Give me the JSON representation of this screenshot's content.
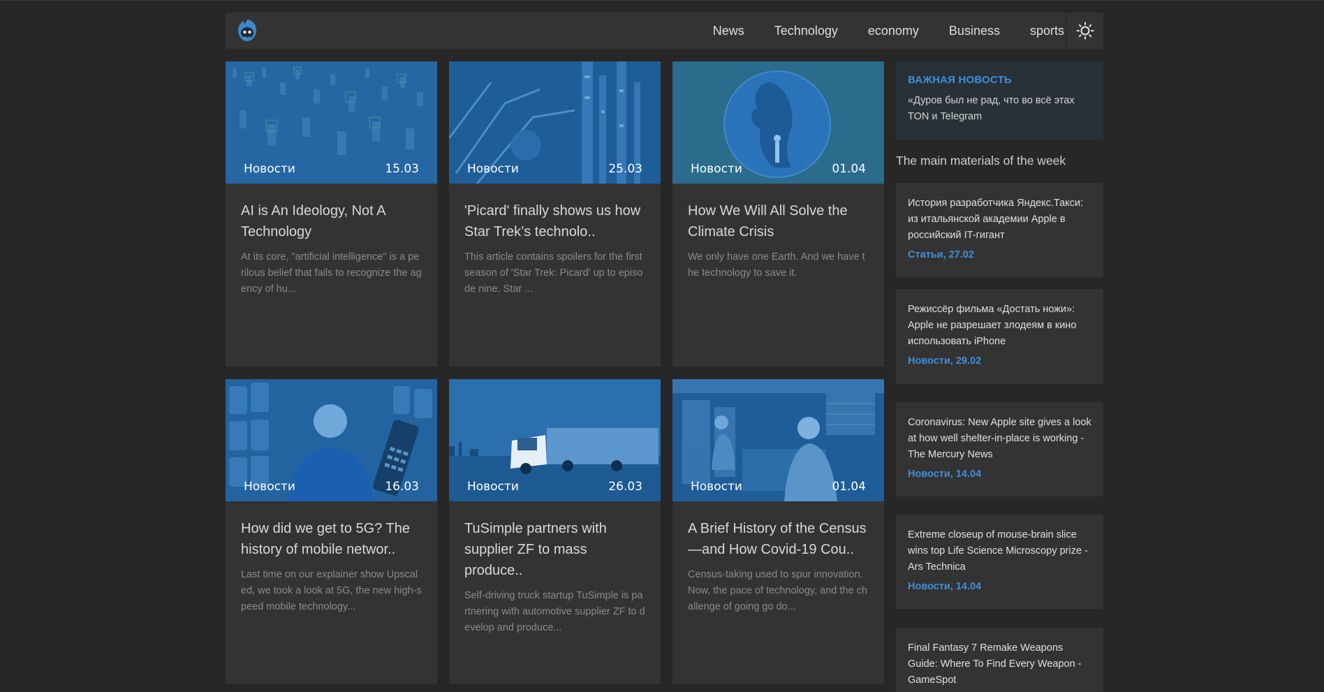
{
  "nav": {
    "items": [
      {
        "label": "News"
      },
      {
        "label": "Technology"
      },
      {
        "label": "economy"
      },
      {
        "label": "Business"
      },
      {
        "label": "sports"
      }
    ]
  },
  "cards": [
    {
      "tag": "Новости",
      "date": "15.03",
      "title": "AI is An Ideology, Not A Technology",
      "text": "At its core, \"artificial intelligence\" is a perilous belief that fails to recognize the agency of hu..."
    },
    {
      "tag": "Новости",
      "date": "25.03",
      "title": "'Picard' finally shows us how Star Trek’s technolo..",
      "text": "This article contains spoilers for the first season of 'Star Trek: Picard' up to episode nine. Star ..."
    },
    {
      "tag": "Новости",
      "date": "01.04",
      "title": "How We Will All Solve the Climate Crisis",
      "text": "We only have one Earth. And we have the technology to save it."
    },
    {
      "tag": "Новости",
      "date": "16.03",
      "title": "How did we get to 5G? The history of mobile networ..",
      "text": "Last time on our explainer show Upscaled, we took a look at 5G, the new high-speed mobile technology..."
    },
    {
      "tag": "Новости",
      "date": "26.03",
      "title": "TuSimple partners with supplier ZF to mass produce..",
      "text": "Self-driving truck startup TuSimple is partnering with automotive supplier ZF to develop and produce..."
    },
    {
      "tag": "Новости",
      "date": "01.04",
      "title": "A Brief History of the Census—and How Covid-19 Cou..",
      "text": "Census-taking used to spur innovation. Now, the pace of technology, and the challenge of going go do..."
    }
  ],
  "sidebar": {
    "important_label": "ВАЖНАЯ НОВОСТЬ",
    "important_text": "«Дуров был не рад, что во всё этах TON и Telegram",
    "week_title": "The main materials of the week",
    "items": [
      {
        "text": "История разработчика Яндекс.Такси: из итальянской академии Apple в российский IT-гигант",
        "meta": "Статьи, 27.02"
      },
      {
        "text": "Режиссёр фильма «Достать ножи»: Apple не разрешает злодеям в кино использовать iPhone",
        "meta": "Новости, 29.02"
      },
      {
        "text": "Coronavirus: New Apple site gives a look at how well shelter-in-place is working - The Mercury News",
        "meta": "Новости, 14.04"
      },
      {
        "text": "Extreme closeup of mouse-brain slice wins top Life Science Microscopy prize - Ars Technica",
        "meta": "Новости, 14.04"
      },
      {
        "text": "Final Fantasy 7 Remake Weapons Guide: Where To Find Every Weapon - GameSpot",
        "meta": ""
      }
    ]
  },
  "colors": {
    "accent": "#3d8fd9",
    "card_bg": "#333333",
    "page_bg": "#272727",
    "image_tint": "#1f5f9a"
  },
  "icons": {
    "logo": "hooded-figure-logo-icon",
    "theme": "sun-icon"
  }
}
